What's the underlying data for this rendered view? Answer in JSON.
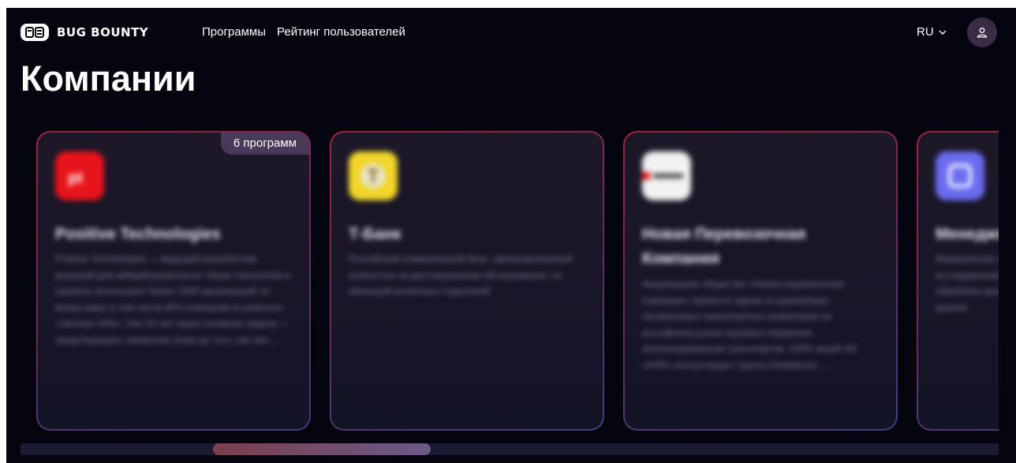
{
  "header": {
    "logo_text": "BUG BOUNTY",
    "nav": [
      "Программы",
      "Рейтинг пользователей"
    ],
    "language": "RU"
  },
  "page": {
    "title": "Компании"
  },
  "companies": [
    {
      "name": "Positive Technologies",
      "badge": "6 программ",
      "logo_color": "#e8141c",
      "description": "Positive Technologies — ведущий разработчик решений для кибербезопасности. Наши технологии и сервисы используют более 2300 организаций по всему миру, в том числе 80% компаний из рейтинга «Эксперт-400». Уже 20 лет наша основная задача — предотвращать хакерские атаки до того, как они ..."
    },
    {
      "name": "Т-Банк",
      "badge": "",
      "logo_color": "#f2d52a",
      "description": "Российский коммерческий банк, сфокусированный полностью на дистанционном обслуживании, не имеющий розничных отделений."
    },
    {
      "name": "Новая Перевозочная Компания",
      "badge": "",
      "logo_color": "#f2f2f2",
      "description": "Акционерное общество «Новая перевозочная компания» является одним из крупнейших независимых транспортных операторов на российском рынке грузовых перевозок железнодорожным транспортом. 100% акций АО «НПК» контролирует Группа Globaltrans. ..."
    },
    {
      "name": "Менеджмент",
      "badge": "",
      "logo_color": "#6b6cf0",
      "description": "Медицинская компания, занимающаяся научными исследованиями и разработкой систем сбора и обработки данных о пациентах для клиник и частных врачей."
    }
  ]
}
